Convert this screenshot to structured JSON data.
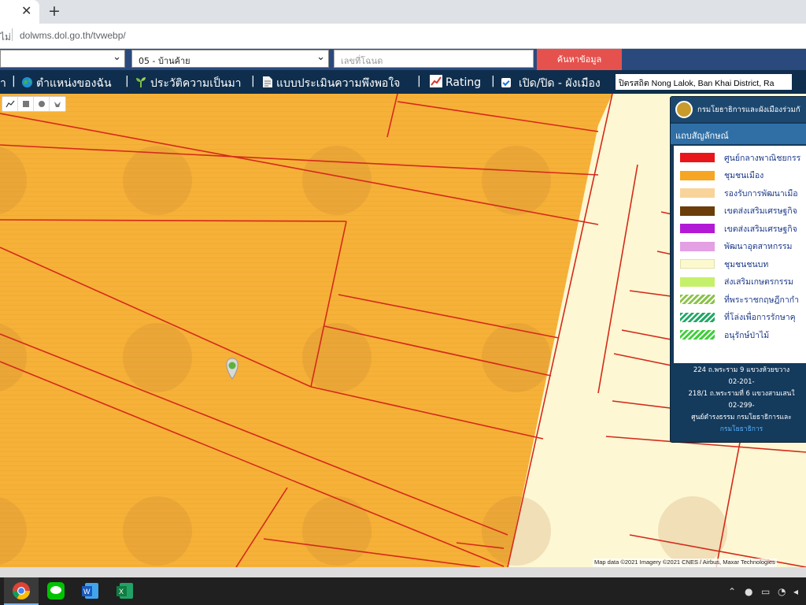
{
  "browser": {
    "tab_close": "✕",
    "new_tab": "+",
    "url_prefix": "ไม่",
    "url": "dolwms.dol.go.th/tvwebp/"
  },
  "search": {
    "select_1_value": "",
    "select_2_value": "05 - บ้านค้าย",
    "parcel_placeholder": "เลขที่โฉนด",
    "search_button": "ค้นหาข้อมูล"
  },
  "toolbar": {
    "item_first": "า",
    "item_location": "ตำแหน่งของฉัน",
    "item_history": "ประวัติความเป็นมา",
    "item_survey": "แบบประเมินความพึงพอใจ",
    "item_rating": "Rating",
    "item_toggle": "เปิด/ปิด - ผังเมือง",
    "separator": "|",
    "location_text": "ปิตรสถิต Nong Lalok, Ban Khai District, Ra"
  },
  "legend": {
    "title": "กรมโยธาธิการและผังเมืองร่วมกั",
    "subtitle": "แถบสัญลักษณ์",
    "items": [
      {
        "label": "ศูนย์กลางพาณิชยกรร",
        "color": "#e8151b"
      },
      {
        "label": "ชุมชนเมือง",
        "color": "#f6a623"
      },
      {
        "label": "รองรับการพัฒนาเมือ",
        "color": "#f9d49a"
      },
      {
        "label": "เขตส่งเสริมเศรษฐกิจ",
        "color": "#6b3d0a"
      },
      {
        "label": "เขตส่งเสริมเศรษฐกิจ",
        "color": "#b31ad6"
      },
      {
        "label": "พัฒนาอุตสาหกรรม",
        "color": "#e3a0e3"
      },
      {
        "label": "ชุมชนชนบท",
        "color": "#fdf9cf"
      },
      {
        "label": "ส่งเสริมเกษตรกรรม",
        "color": "#c5f06b"
      },
      {
        "label": "ที่พระราชกฤษฎีกากำ",
        "color": "#8bc34a"
      },
      {
        "label": "ที่โล่งเพื่อการรักษาคุ",
        "color": "#23a868"
      },
      {
        "label": "อนุรักษ์ป่าไม้",
        "color": "#3fcf3a"
      }
    ],
    "footer_lines": [
      "224 ถ.พระราม 9 แขวงห้วยขวาง",
      "02-201-",
      "218/1 ถ.พระรามที่ 6 แขวงสามเสนใ",
      "02-299-",
      "ศูนย์ดำรงธรรม กรมโยธาธิการและ",
      "กรมโยธาธิการ"
    ]
  },
  "map": {
    "attribution": "Map data ©2021 Imagery ©2021 CNES / Airbus, Maxar Technologies",
    "zone_color": "#f6b138",
    "rural_color": "#fdf7d3",
    "line_color": "#d42a1a"
  }
}
